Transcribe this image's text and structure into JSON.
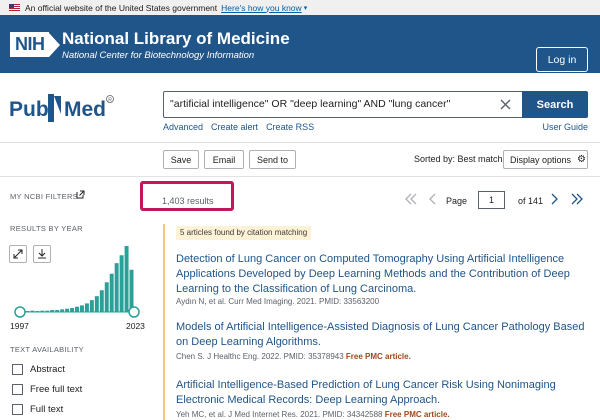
{
  "gov_banner": {
    "text": "An official website of the United States government",
    "link": "Here's how you know"
  },
  "nlm_header": {
    "title": "National Library of Medicine",
    "subtitle": "National Center for Biotechnology Information",
    "badge": "NIH",
    "login_label": "Log in"
  },
  "pubmed": {
    "logo_left": "Pub",
    "logo_right": "Med"
  },
  "search": {
    "query": "\"artificial intelligence\" OR \"deep learning\" AND \"lung cancer\"",
    "button": "Search",
    "links": [
      "Advanced",
      "Create alert",
      "Create RSS"
    ],
    "user_guide": "User Guide"
  },
  "actions": {
    "save": "Save",
    "email": "Email",
    "send_to": "Send to",
    "sorted_by": "Sorted by: Best match",
    "display_options": "Display options"
  },
  "sidebar": {
    "filters_label": "MY NCBI FILTERS",
    "results_by_year_label": "RESULTS BY YEAR",
    "year_start": "1997",
    "year_end": "2023",
    "histogram": [
      1,
      1,
      2,
      1,
      2,
      2,
      3,
      3,
      4,
      5,
      6,
      8,
      10,
      13,
      18,
      24,
      33,
      45,
      58,
      74,
      86,
      100,
      64
    ],
    "text_availability_label": "TEXT AVAILABILITY",
    "checkboxes": [
      "Abstract",
      "Free full text",
      "Full text"
    ]
  },
  "results": {
    "count": "1,403 results",
    "page_label": "Page",
    "page_value": "1",
    "of_pages": "of 141",
    "citation_note": "5 articles found by citation matching",
    "items": [
      {
        "title": "Detection of Lung Cancer on Computed Tomography Using Artificial Intelligence Applications Developed by Deep Learning Methods and the Contribution of Deep Learning to the Classification of Lung Carcinoma.",
        "meta": "Aydın N, et al. Curr Med Imaging. 2021. PMID: 33563200",
        "free": ""
      },
      {
        "title": "Models of Artificial Intelligence-Assisted Diagnosis of Lung Cancer Pathology Based on Deep Learning Algorithms.",
        "meta": "Chen S. J Healthc Eng. 2022. PMID: 35378943",
        "free": "Free PMC article."
      },
      {
        "title": "Artificial Intelligence-Based Prediction of Lung Cancer Risk Using Nonimaging Electronic Medical Records: Deep Learning Approach.",
        "meta": "Yeh MC, et al. J Med Internet Res. 2021. PMID: 34342588",
        "free": "Free PMC article."
      }
    ]
  },
  "colors": {
    "nlm_blue": "#20558a",
    "highlight": "#c2185b",
    "bar_green": "#2aa198",
    "free_pmc": "#a0471d"
  }
}
